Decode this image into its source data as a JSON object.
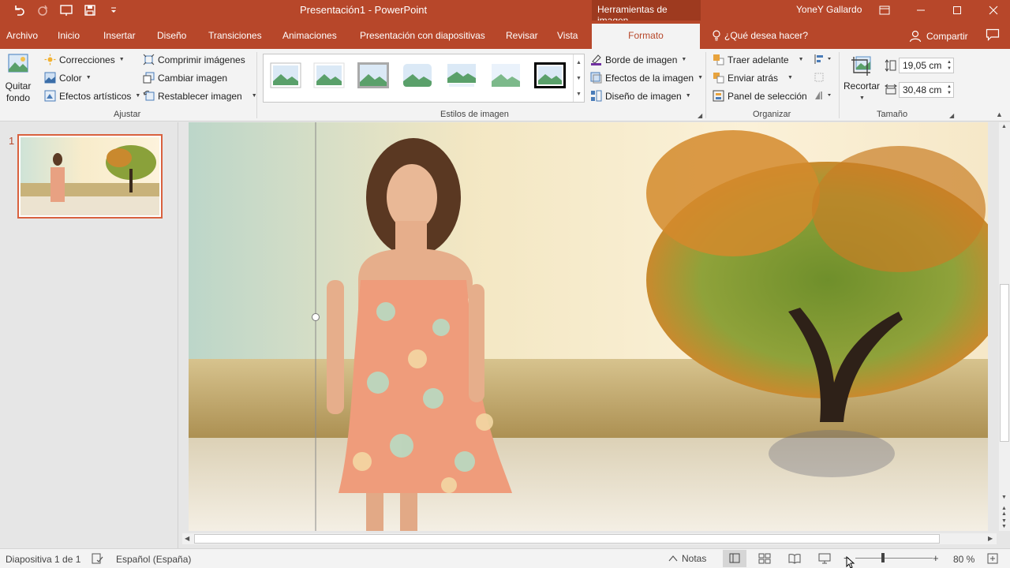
{
  "titlebar": {
    "document_title": "Presentación1  -  PowerPoint",
    "tools_label": "Herramientas de imagen",
    "user": "YoneY Gallardo"
  },
  "tabs": [
    "Archivo",
    "Inicio",
    "Insertar",
    "Diseño",
    "Transiciones",
    "Animaciones",
    "Presentación con diapositivas",
    "Revisar",
    "Vista",
    "Formato"
  ],
  "active_tab": "Formato",
  "help_search": "¿Qué desea hacer?",
  "share_label": "Compartir",
  "ribbon": {
    "ajustar": {
      "quitar_fondo": "Quitar fondo",
      "correcciones": "Correcciones",
      "color": "Color",
      "efectos_artisticos": "Efectos artísticos",
      "comprimir": "Comprimir imágenes",
      "cambiar": "Cambiar imagen",
      "restablecer": "Restablecer imagen",
      "label": "Ajustar"
    },
    "estilos": {
      "borde": "Borde de imagen",
      "efectos": "Efectos de la imagen",
      "diseno": "Diseño de imagen",
      "label": "Estilos de imagen"
    },
    "organizar": {
      "traer": "Traer adelante",
      "enviar": "Enviar atrás",
      "panel": "Panel de selección",
      "label": "Organizar"
    },
    "tamano": {
      "recortar": "Recortar",
      "height": "19,05 cm",
      "width": "30,48 cm",
      "label": "Tamaño"
    }
  },
  "thumbnails": [
    {
      "number": "1"
    }
  ],
  "statusbar": {
    "slide_info": "Diapositiva 1 de 1",
    "language": "Español (España)",
    "notes": "Notas",
    "zoom": "80 %"
  },
  "colors": {
    "accent": "#b7472a",
    "ribbon_bg": "#f3f3f3",
    "app_bg": "#e6e6e6"
  }
}
